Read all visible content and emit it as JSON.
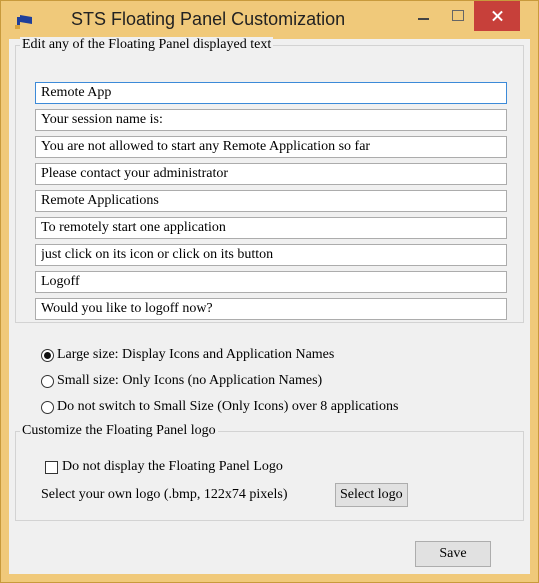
{
  "window": {
    "title": "STS Floating Panel Customization"
  },
  "text_group": {
    "legend": "Edit any of the Floating Panel displayed text",
    "fields": [
      "Remote App",
      "Your session name is:",
      "You are not allowed to start any Remote Application so far",
      "Please contact your administrator",
      "Remote Applications",
      "To remotely start one application",
      "just click on its icon or click on its button",
      "Logoff",
      "Would you like to logoff now?"
    ]
  },
  "size_options": [
    {
      "label": "Large size: Display Icons and Application Names",
      "checked": true
    },
    {
      "label": "Small size: Only Icons (no Application Names)",
      "checked": false
    },
    {
      "label": "Do not switch to Small Size (Only Icons) over 8 applications",
      "checked": false
    }
  ],
  "logo_group": {
    "legend": "Customize the Floating Panel logo",
    "checkbox_label": "Do not display the Floating Panel Logo",
    "checkbox_checked": false,
    "select_text": "Select your own logo (.bmp, 122x74 pixels)",
    "select_button": "Select logo"
  },
  "buttons": {
    "save": "Save"
  }
}
